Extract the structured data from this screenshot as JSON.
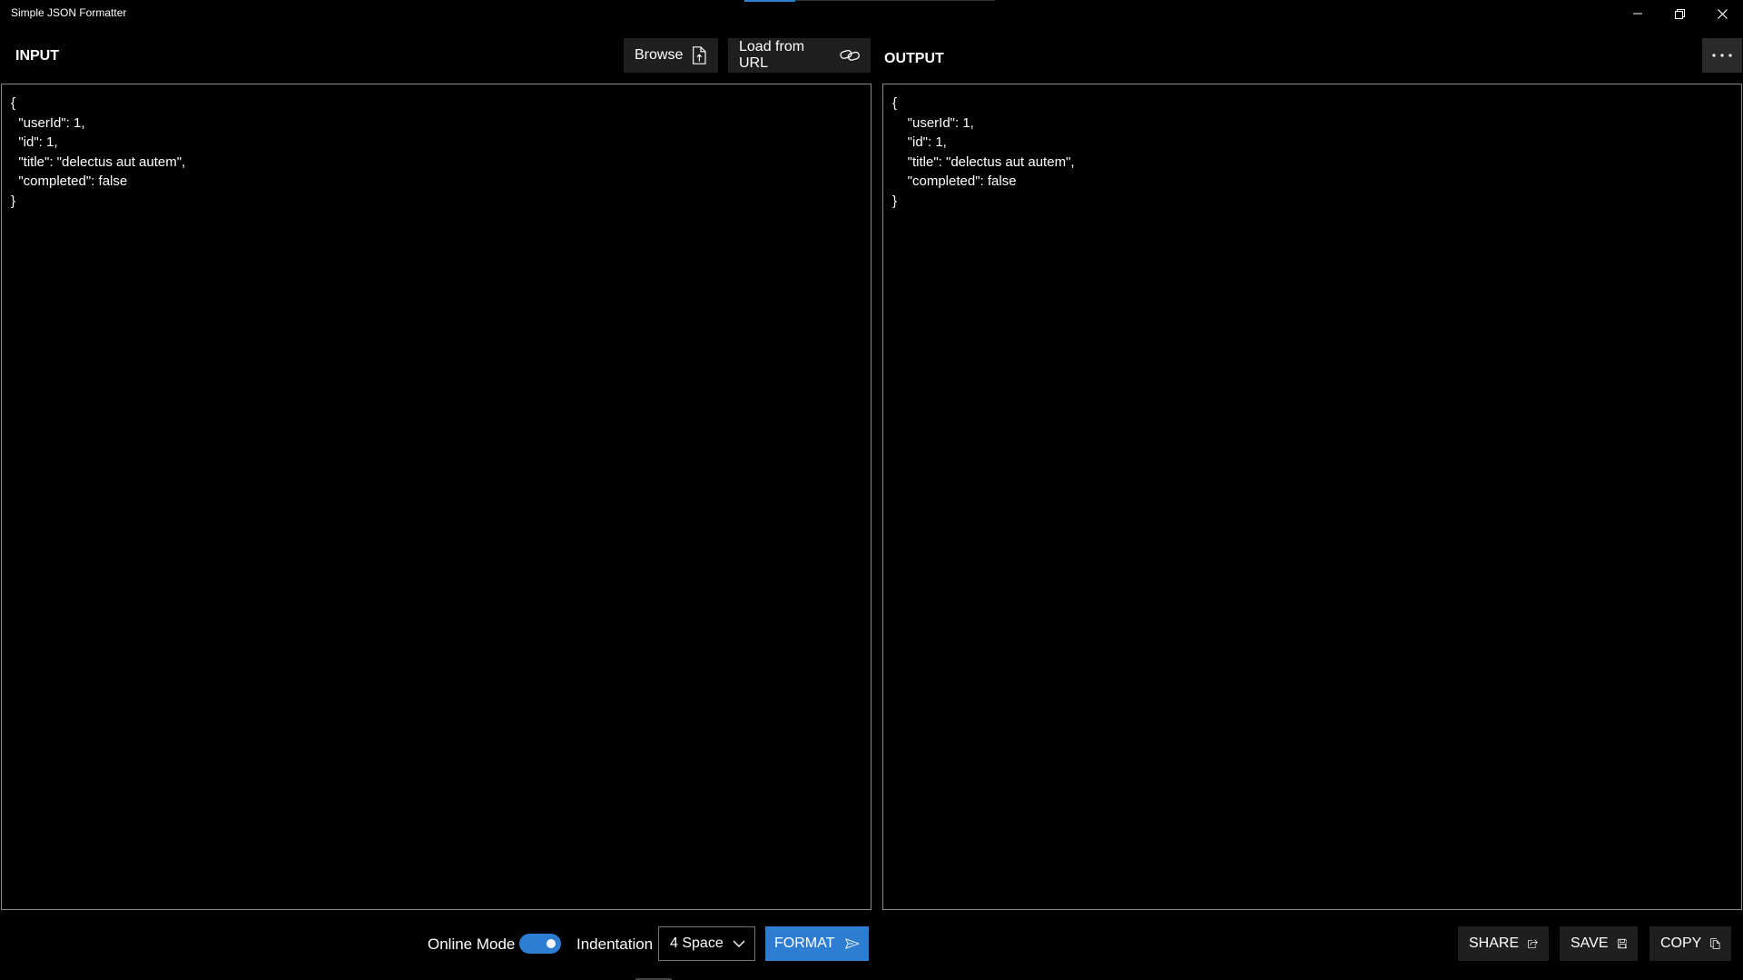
{
  "window": {
    "title": "Simple JSON Formatter",
    "minimize_icon": "minimize-icon",
    "restore_icon": "restore-icon",
    "close_icon": "close-icon"
  },
  "input": {
    "label": "INPUT",
    "browse_label": "Browse",
    "browse_icon": "file-upload-icon",
    "load_url_label": "Load from URL",
    "load_url_icon": "link-icon",
    "text": "{\n  \"userId\": 1,\n  \"id\": 1,\n  \"title\": \"delectus aut autem\",\n  \"completed\": false\n}"
  },
  "output": {
    "label": "OUTPUT",
    "more_icon": "more-horizontal-icon",
    "text": "{\n    \"userId\": 1,\n    \"id\": 1,\n    \"title\": \"delectus aut autem\",\n    \"completed\": false\n}"
  },
  "controls": {
    "online_mode_label": "Online Mode",
    "online_mode_on": true,
    "indentation_label": "Indentation",
    "indentation_value": "4 Space",
    "format_label": "FORMAT",
    "format_icon": "send-icon"
  },
  "actions": {
    "share_label": "SHARE",
    "share_icon": "share-icon",
    "save_label": "SAVE",
    "save_icon": "save-icon",
    "copy_label": "COPY",
    "copy_icon": "copy-icon"
  },
  "colors": {
    "background": "#000000",
    "accent": "#2d7dd2",
    "button_bg": "#1f1f1f",
    "border": "#8a8a8a"
  }
}
